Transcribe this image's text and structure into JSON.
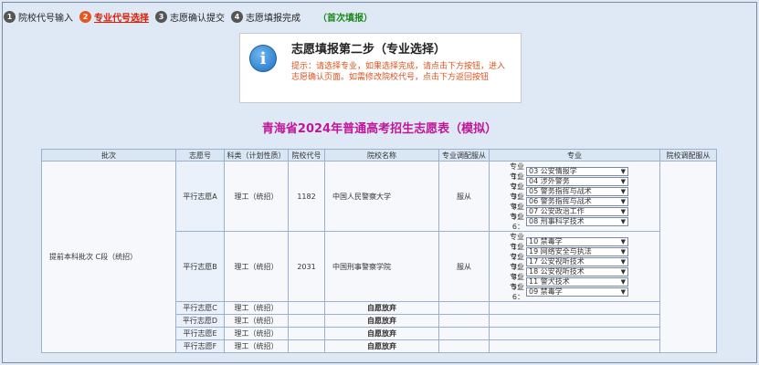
{
  "steps": [
    {
      "num": "1",
      "label": "院校代号输入",
      "active": false
    },
    {
      "num": "2",
      "label": "专业代号选择",
      "active": true
    },
    {
      "num": "3",
      "label": "志愿确认提交",
      "active": false
    },
    {
      "num": "4",
      "label": "志愿填报完成",
      "active": false
    }
  ],
  "fill_status": "（首次填报）",
  "info": {
    "title": "志愿填报第二步（专业选择）",
    "text": "提示：请选择专业，如果选择完成，请点击下方按钮，进入志愿确认页面。如需修改院校代号，点击下方返回按钮"
  },
  "page_title": "青海省2024年普通高考招生志愿表（模拟）",
  "table": {
    "headers": [
      "批次",
      "志愿号",
      "科类（计划性质）",
      "院校代号",
      "院校名称",
      "专业调配服从",
      "专业",
      "院校调配服从"
    ],
    "batch": "提前本科批次 C段（统招）",
    "rows": [
      {
        "wish": "平行志愿A",
        "category": "理工（统招）",
        "code": "1182",
        "school": "中国人民警察大学",
        "obey": "服从",
        "majors": [
          {
            "label": "专业1：",
            "value": "03 公安情报学"
          },
          {
            "label": "专业2：",
            "value": "04 涉外警务"
          },
          {
            "label": "专业3：",
            "value": "05 警务指挥与战术"
          },
          {
            "label": "专业4：",
            "value": "06 警务指挥与战术"
          },
          {
            "label": "专业5：",
            "value": "07 公安政治工作"
          },
          {
            "label": "专业6：",
            "value": "08 刑事科学技术"
          }
        ]
      },
      {
        "wish": "平行志愿B",
        "category": "理工（统招）",
        "code": "2031",
        "school": "中国刑事警察学院",
        "obey": "服从",
        "majors": [
          {
            "label": "专业1：",
            "value": "10 禁毒学"
          },
          {
            "label": "专业2：",
            "value": "19 网络安全与执法"
          },
          {
            "label": "专业3：",
            "value": "17 公安视听技术"
          },
          {
            "label": "专业4：",
            "value": "18 公安视听技术"
          },
          {
            "label": "专业5：",
            "value": "11 警犬技术"
          },
          {
            "label": "专业6：",
            "value": "09 禁毒学"
          }
        ]
      }
    ],
    "short_rows": [
      {
        "wish": "平行志愿C",
        "category": "理工（统招）",
        "status": "自愿放弃"
      },
      {
        "wish": "平行志愿D",
        "category": "理工（统招）",
        "status": "自愿放弃"
      },
      {
        "wish": "平行志愿E",
        "category": "理工（统招）",
        "status": "自愿放弃"
      },
      {
        "wish": "平行志愿F",
        "category": "理工（统招）",
        "status": "自愿放弃"
      }
    ]
  }
}
